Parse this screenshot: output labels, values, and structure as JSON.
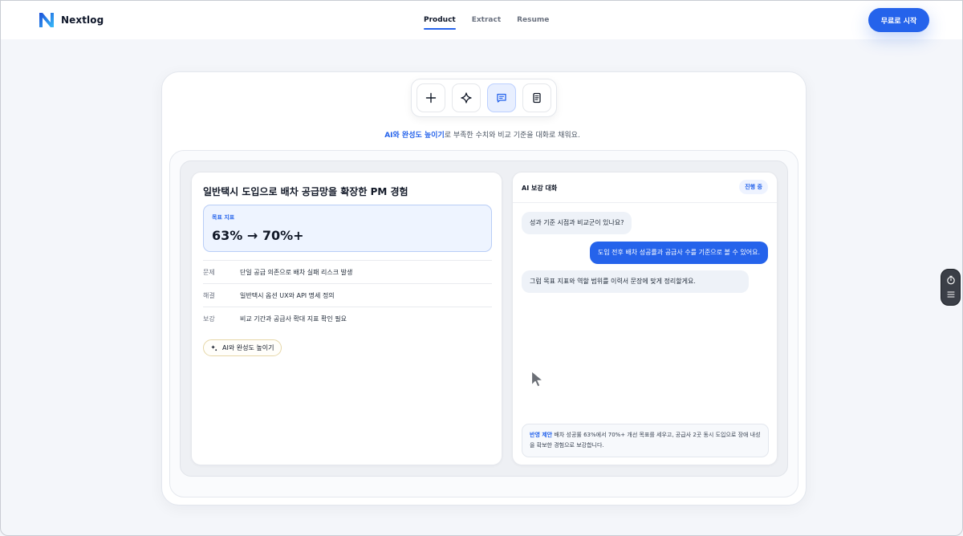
{
  "header": {
    "brand": "Nextlog",
    "nav": [
      {
        "label": "Product",
        "active": true
      },
      {
        "label": "Extract",
        "active": false
      },
      {
        "label": "Resume",
        "active": false
      }
    ],
    "cta_label": "무료로 시작"
  },
  "toolbar": {
    "buttons": [
      {
        "icon": "plus-icon",
        "active": false
      },
      {
        "icon": "sparkle-icon",
        "active": false
      },
      {
        "icon": "chat-icon",
        "active": true
      },
      {
        "icon": "document-icon",
        "active": false
      }
    ]
  },
  "tagline": {
    "highlight": "AI와 완성도 높이기",
    "rest": "로 부족한 수치와 비교 기준을 대화로 채워요."
  },
  "left_card": {
    "title": "일반택시 도입으로 배차 공급망을 확장한 PM 경험",
    "metric_label": "목표 지표",
    "metric_value": "63% → 70%+",
    "rows": [
      {
        "key": "문제",
        "value": "단일 공급 의존으로 배차 실패 리스크 발생"
      },
      {
        "key": "해결",
        "value": "일반택시 옵션 UX와 API 명세 정의"
      },
      {
        "key": "보강",
        "value": "비교 기간과 공급사 확대 지표 확인 필요"
      }
    ],
    "ai_button": "AI와 완성도 높이기"
  },
  "right_card": {
    "title": "AI 보강 대화",
    "badge": "진행 중",
    "messages": [
      {
        "role": "ai",
        "text": "성과 기준 시점과 비교군이 있나요?"
      },
      {
        "role": "user",
        "text": "도입 전후 배차 성공률과 공급사 수를 기준으로 볼 수 있어요."
      },
      {
        "role": "ai",
        "text": "그럼 목표 지표와 역할 범위를 이력서 문장에 맞게 정리할게요."
      }
    ],
    "suggestion_label": "반영 제안",
    "suggestion_text": " 배차 성공률 63%에서 70%+ 개선 목표를 세우고, 공급사 2곳 동시 도입으로 장애 내성을 확보한 경험으로 보강합니다."
  },
  "colors": {
    "accent": "#2563eb",
    "metric_bg": "#eef4ff"
  }
}
